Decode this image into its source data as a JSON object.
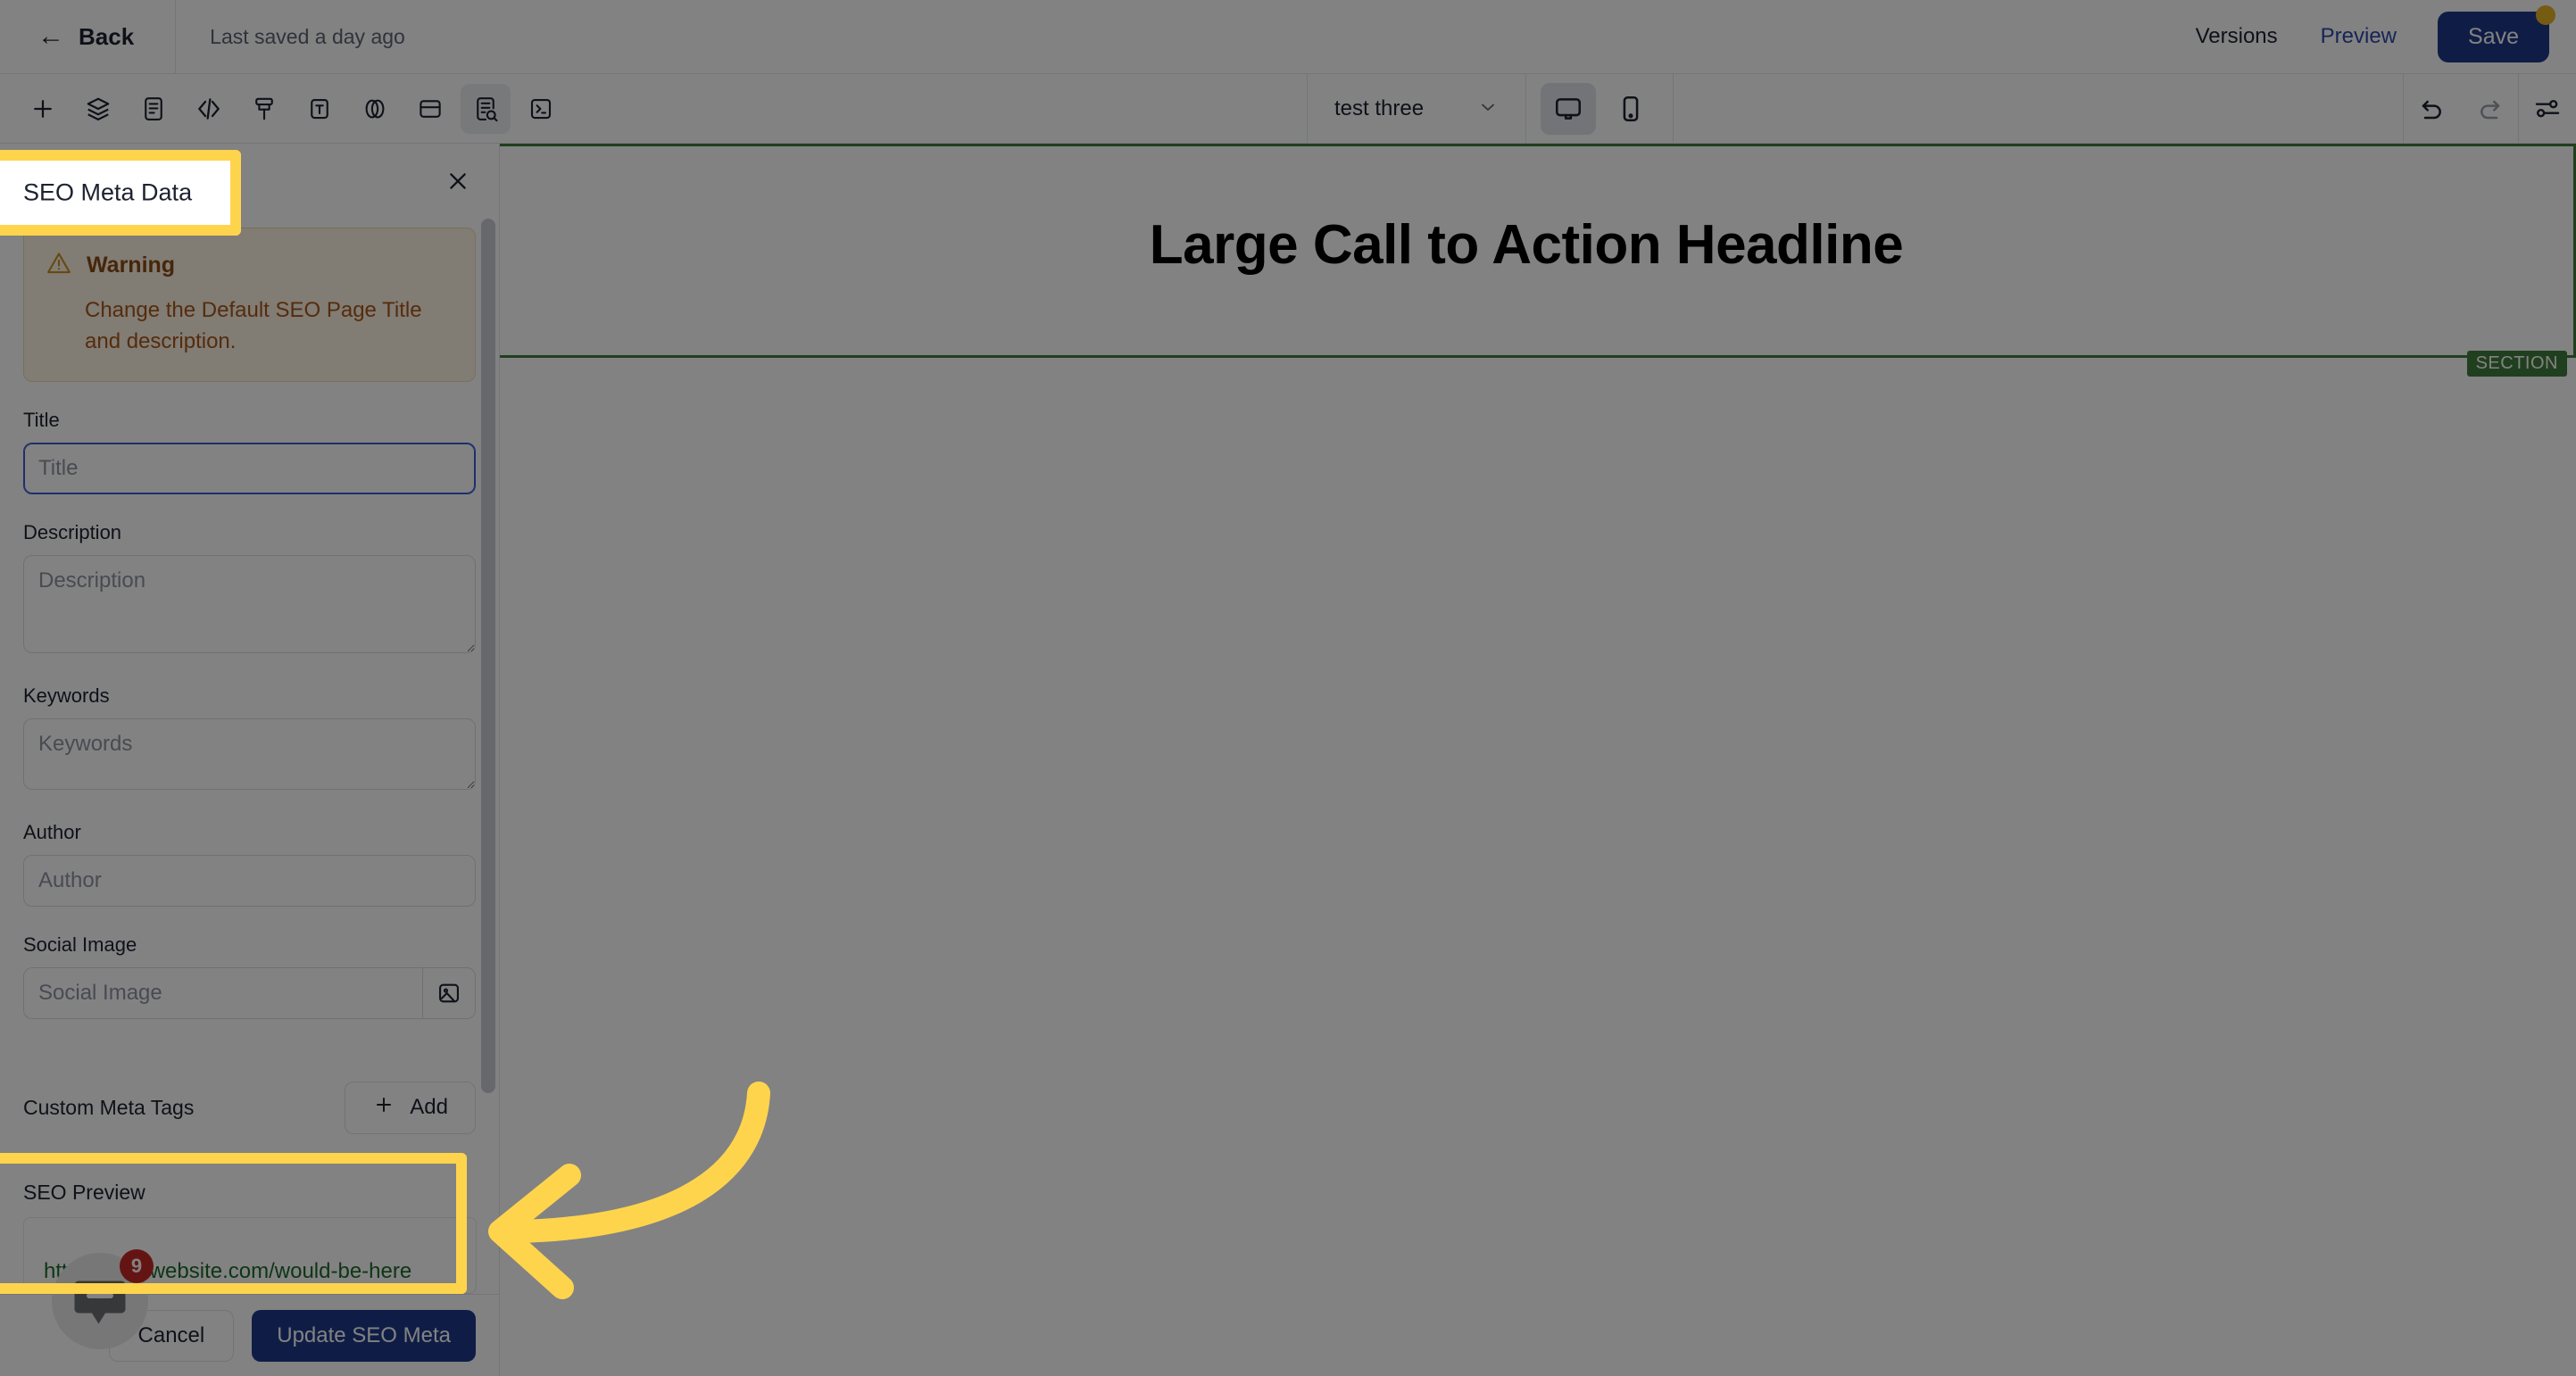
{
  "header": {
    "back_label": "Back",
    "back_icon": "arrow-left-icon",
    "saved_text": "Last saved a day ago",
    "versions_label": "Versions",
    "preview_label": "Preview",
    "save_label": "Save"
  },
  "toolbar": {
    "left_icons": [
      {
        "name": "plus-icon",
        "title": "Add"
      },
      {
        "name": "layers-icon",
        "title": "Layers"
      },
      {
        "name": "document-icon",
        "title": "Pages"
      },
      {
        "name": "code-icon",
        "title": "Code"
      },
      {
        "name": "brush-icon",
        "title": "Styles"
      },
      {
        "name": "text-box-icon",
        "title": "Typography"
      },
      {
        "name": "color-palette-icon",
        "title": "Colors"
      },
      {
        "name": "layout-icon",
        "title": "Layout"
      },
      {
        "name": "seo-document-search-icon",
        "title": "SEO Meta Data"
      },
      {
        "name": "terminal-icon",
        "title": "Console"
      }
    ],
    "active_left_icon": "seo-document-search-icon",
    "page_name": "test three",
    "page_chevron_icon": "chevron-down-icon",
    "devices": [
      {
        "name": "desktop-icon",
        "label": "Desktop",
        "active": true
      },
      {
        "name": "mobile-icon",
        "label": "Mobile",
        "active": false
      }
    ],
    "right_icons": [
      {
        "name": "undo-icon",
        "title": "Undo"
      },
      {
        "name": "redo-icon",
        "title": "Redo"
      },
      {
        "name": "settings-sliders-icon",
        "title": "Settings"
      }
    ]
  },
  "canvas": {
    "headline": "Large Call to Action Headline",
    "section_badge": "SECTION",
    "section_border_color": "#3f7d3c"
  },
  "panel": {
    "title": "SEO Meta Data",
    "close_icon": "close-icon",
    "warning": {
      "icon": "warning-triangle-icon",
      "title": "Warning",
      "message": "Change the Default SEO Page Title and description."
    },
    "fields": {
      "title": {
        "label": "Title",
        "placeholder": "Title",
        "value": "",
        "focused": true
      },
      "description": {
        "label": "Description",
        "placeholder": "Description",
        "value": ""
      },
      "keywords": {
        "label": "Keywords",
        "placeholder": "Keywords",
        "value": ""
      },
      "author": {
        "label": "Author",
        "placeholder": "Author",
        "value": ""
      },
      "social_image": {
        "label": "Social Image",
        "placeholder": "Social Image",
        "value": "",
        "picker_icon": "image-picker-icon"
      }
    },
    "custom_meta": {
      "label": "Custom Meta Tags",
      "add_label": "Add",
      "add_icon": "plus-icon"
    },
    "seo_preview": {
      "label": "SEO Preview",
      "url": "https://yourwebsite.com/would-be-here"
    },
    "footer": {
      "cancel_label": "Cancel",
      "update_label": "Update SEO Meta"
    }
  },
  "chat_widget": {
    "icon": "chat-bubble-icon",
    "badge_count": "9"
  },
  "annotations": {
    "highlight_color": "#ffd44d",
    "arrow_icon": "curved-arrow-left-icon",
    "title_highlight_text": "SEO Meta Data"
  },
  "colors": {
    "primary": "#1e3a8a",
    "link": "#2f49a8",
    "warning_text": "#a8571a",
    "section_green": "#3f7d3c",
    "badge_red": "#c62828",
    "url_green": "#1d6b2a",
    "accent_yellow": "#ffd44d"
  }
}
